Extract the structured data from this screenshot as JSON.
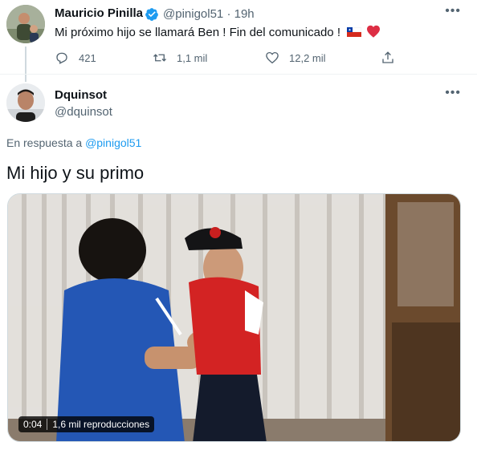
{
  "tweet_parent": {
    "display_name": "Mauricio Pinilla",
    "handle": "@pinigol51",
    "separator": "·",
    "time": "19h",
    "text": "Mi próximo hijo se llamará Ben ! Fin del comunicado !",
    "emojis": [
      "chile-flag",
      "red-heart"
    ],
    "replies": "421",
    "retweets": "1,1 mil",
    "likes": "12,2 mil"
  },
  "tweet_reply": {
    "display_name": "Dquinsot",
    "handle": "@dquinsot",
    "reply_prefix": "En respuesta a",
    "reply_mention": "@pinigol51",
    "text": "Mi hijo y su primo",
    "video": {
      "duration": "0:04",
      "views": "1,6 mil reproducciones"
    }
  },
  "colors": {
    "link_blue": "#1d9bf0",
    "text_secondary": "#536471",
    "verified_blue": "#1d9bf0"
  }
}
